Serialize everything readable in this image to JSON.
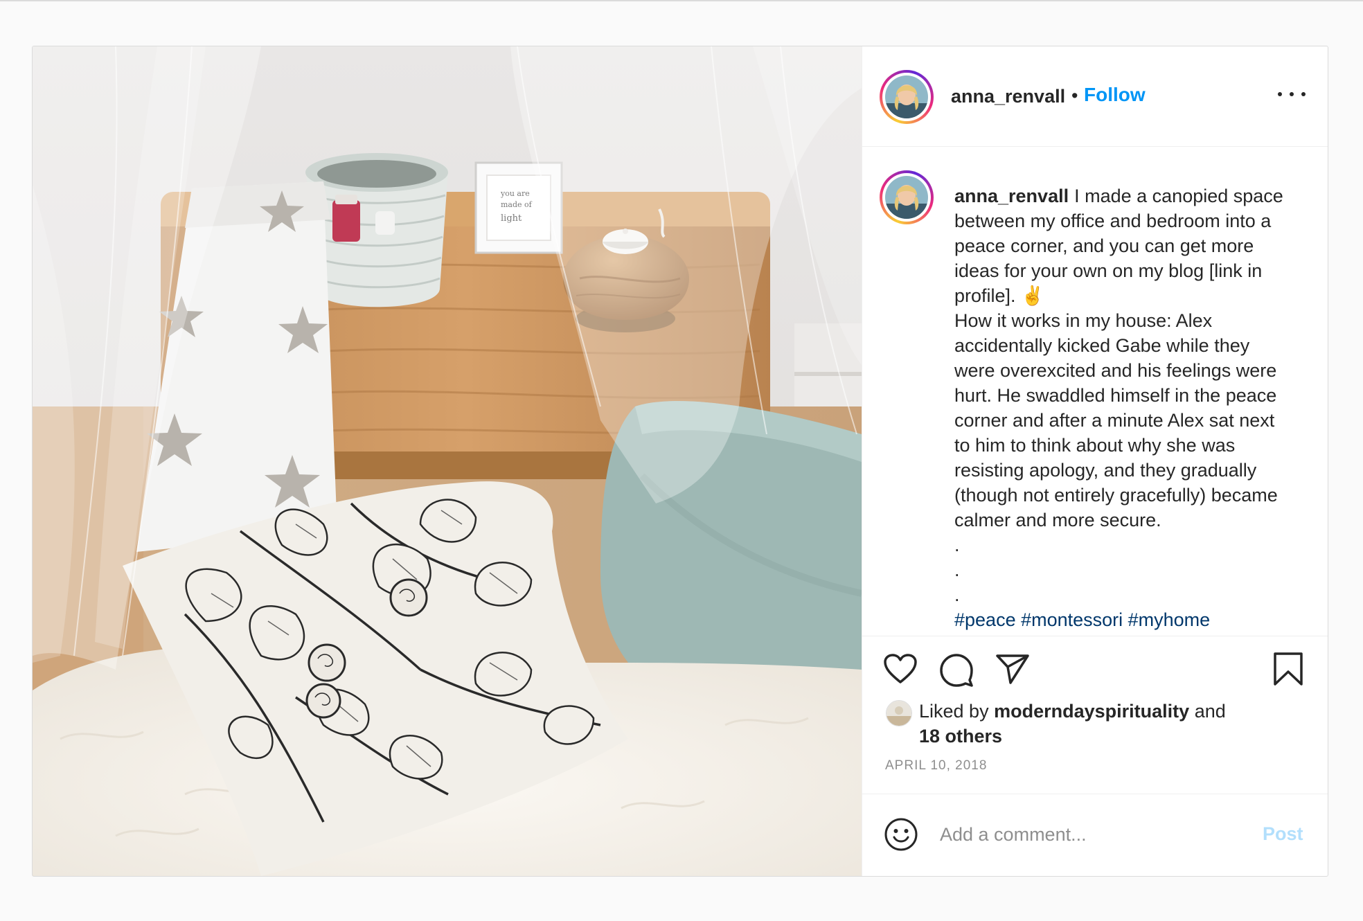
{
  "post": {
    "username": "anna_renvall",
    "separator": "•",
    "follow_label": "Follow",
    "more_icon": "more-horizontal-icon",
    "caption": {
      "username": "anna_renvall",
      "paragraph1": "I made a canopied space between my office and bedroom into a peace corner, and you can get more ideas for your own on my blog [link in profile]. ✌️",
      "paragraph2": "How it works in my house: Alex accidentally kicked Gabe while they were overexcited and his feelings were hurt. He swaddled himself in the peace corner and after a minute Alex sat next to him to think about why she was resisting apology, and they gradually (though not entirely gracefully) became calmer and more secure.",
      "dot1": ".",
      "dot2": ".",
      "dot3": ".",
      "hashtags": "#peace #montessori #myhome"
    },
    "actions": {
      "like_icon": "heart-icon",
      "comment_icon": "comment-icon",
      "share_icon": "paper-plane-icon",
      "save_icon": "bookmark-icon"
    },
    "likes": {
      "prefix": "Liked by",
      "user": "moderndayspirituality",
      "connector": "and",
      "others": "18 others"
    },
    "date": "APRIL 10, 2018",
    "comment": {
      "placeholder": "Add a comment...",
      "post_label": "Post",
      "emoji_icon": "smiley-icon"
    }
  },
  "image_text": {
    "frame_text": "you are made of light"
  },
  "colors": {
    "follow_blue": "#0095f6",
    "post_disabled": "#b2dffc",
    "hashtag": "#00376b",
    "meta_gray": "#8e8e8e"
  }
}
